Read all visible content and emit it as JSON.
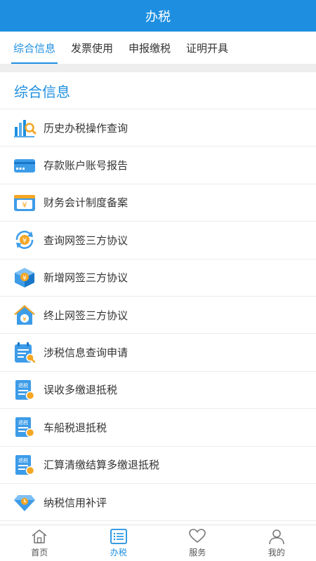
{
  "header": {
    "title": "办税"
  },
  "tabs": [
    {
      "label": "综合信息",
      "active": true
    },
    {
      "label": "发票使用"
    },
    {
      "label": "申报缴税"
    },
    {
      "label": "证明开具"
    }
  ],
  "section": {
    "title": "综合信息"
  },
  "items": [
    {
      "label": "历史办税操作查询",
      "icon": "chart-search-icon"
    },
    {
      "label": "存款账户账号报告",
      "icon": "bank-card-icon"
    },
    {
      "label": "财务会计制度备案",
      "icon": "yuan-note-icon"
    },
    {
      "label": "查询网签三方协议",
      "icon": "yuan-refresh-icon"
    },
    {
      "label": "新增网签三方协议",
      "icon": "yuan-box-icon"
    },
    {
      "label": "终止网签三方协议",
      "icon": "yuan-house-icon"
    },
    {
      "label": "涉税信息查询申请",
      "icon": "calendar-search-icon"
    },
    {
      "label": "误收多缴退抵税",
      "icon": "tax-refund-doc-icon"
    },
    {
      "label": "车船税退抵税",
      "icon": "tax-refund-doc-icon"
    },
    {
      "label": "汇算清缴结算多缴退抵税",
      "icon": "tax-refund-doc-icon"
    },
    {
      "label": "纳税信用补评",
      "icon": "diamond-icon"
    }
  ],
  "tabbar": [
    {
      "label": "首页",
      "icon": "home-icon"
    },
    {
      "label": "办税",
      "icon": "list-icon",
      "active": true
    },
    {
      "label": "服务",
      "icon": "heart-icon"
    },
    {
      "label": "我的",
      "icon": "user-icon"
    }
  ],
  "colors": {
    "accent": "#1e8fe0",
    "orange": "#f5a623"
  },
  "refund_tag": "退税"
}
